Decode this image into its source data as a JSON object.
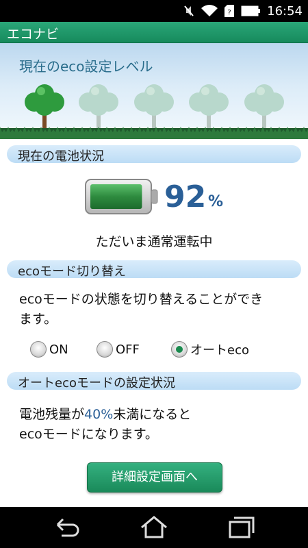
{
  "status_bar": {
    "time": "16:54",
    "icons": [
      "mute-icon",
      "wifi-icon",
      "sim-icon",
      "battery-icon"
    ]
  },
  "app": {
    "title": "エコナビ"
  },
  "eco_level": {
    "title": "現在のeco設定レベル",
    "trees_active": 1,
    "trees_total": 5
  },
  "battery_section": {
    "header": "現在の電池状況",
    "percent": "92",
    "unit": "%",
    "level": 0.92,
    "status": "ただいま通常運転中"
  },
  "eco_mode": {
    "header": "ecoモード切り替え",
    "description_line1": "ecoモードの状態を切り替えることができ",
    "description_line2": "ます。",
    "options": [
      "ON",
      "OFF",
      "オートeco"
    ],
    "selected": "オートeco"
  },
  "auto_eco": {
    "header": "オートecoモードの設定状況",
    "text_prefix": "電池残量が",
    "threshold": "40%",
    "text_suffix": "未満になると",
    "text_line2": "ecoモードになります。"
  },
  "detail_button": {
    "label": "詳細設定画面へ"
  },
  "colors": {
    "title_bar": "#1f9a6c",
    "section_header": "#c9e3f8",
    "accent_blue": "#2a5f97",
    "button_green": "#23a06c"
  }
}
